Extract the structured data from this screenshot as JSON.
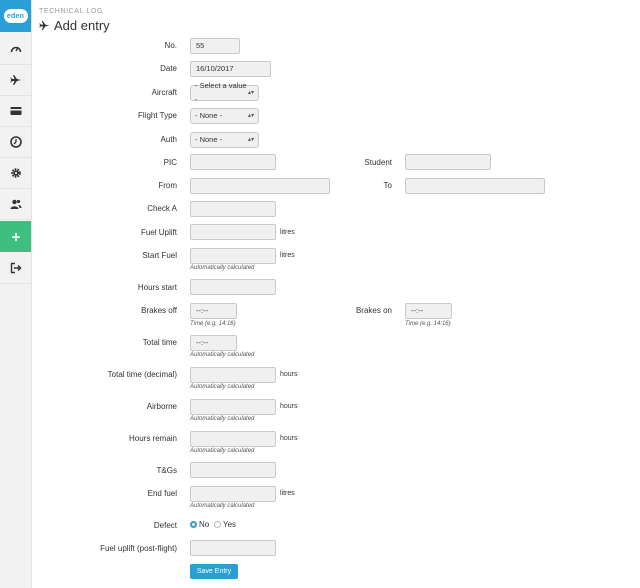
{
  "app": {
    "logo_text": "eden"
  },
  "header": {
    "breadcrumb": "TECHNICAL LOG",
    "title": "Add entry"
  },
  "form": {
    "no": {
      "label": "No.",
      "value": "55"
    },
    "date": {
      "label": "Date",
      "value": "16/10/2017"
    },
    "aircraft": {
      "label": "Aircraft",
      "value": "- Select a value -"
    },
    "flight_type": {
      "label": "Flight Type",
      "value": "- None -"
    },
    "auth": {
      "label": "Auth",
      "value": "- None -"
    },
    "pic": {
      "label": "PIC",
      "value": ""
    },
    "student": {
      "label": "Student",
      "value": ""
    },
    "from": {
      "label": "From",
      "value": ""
    },
    "to": {
      "label": "To",
      "value": ""
    },
    "check_a": {
      "label": "Check A",
      "value": ""
    },
    "fuel_uplift": {
      "label": "Fuel Uplift",
      "value": "",
      "unit": "litres"
    },
    "start_fuel": {
      "label": "Start Fuel",
      "value": "",
      "unit": "litres",
      "hint": "Automatically calculated"
    },
    "hours_start": {
      "label": "Hours start",
      "value": ""
    },
    "brakes_off": {
      "label": "Brakes off",
      "value": "--:--",
      "hint": "Time (e.g. 14:16)"
    },
    "brakes_on": {
      "label": "Brakes on",
      "value": "--:--",
      "hint": "Time (e.g. 14:16)"
    },
    "total_time": {
      "label": "Total time",
      "value": "--:--",
      "hint": "Automatically calculated"
    },
    "total_time_decimal": {
      "label": "Total time (decimal)",
      "value": "",
      "unit": "hours",
      "hint": "Automatically calculated"
    },
    "airborne": {
      "label": "Airborne",
      "value": "",
      "unit": "hours",
      "hint": "Automatically calculated"
    },
    "hours_remain": {
      "label": "Hours remain",
      "value": "",
      "unit": "hours",
      "hint": "Automatically calculated"
    },
    "tgs": {
      "label": "T&Gs",
      "value": ""
    },
    "end_fuel": {
      "label": "End fuel",
      "value": "",
      "unit": "litres",
      "hint": "Automatically calculated"
    },
    "defect": {
      "label": "Defect",
      "options": [
        "No",
        "Yes"
      ],
      "selected": "No"
    },
    "fuel_uplift_post": {
      "label": "Fuel uplift (post-flight)",
      "value": ""
    },
    "save_label": "Save Entry"
  },
  "colors": {
    "accent": "#2a9fd6",
    "active_nav": "#3fbf7f"
  }
}
